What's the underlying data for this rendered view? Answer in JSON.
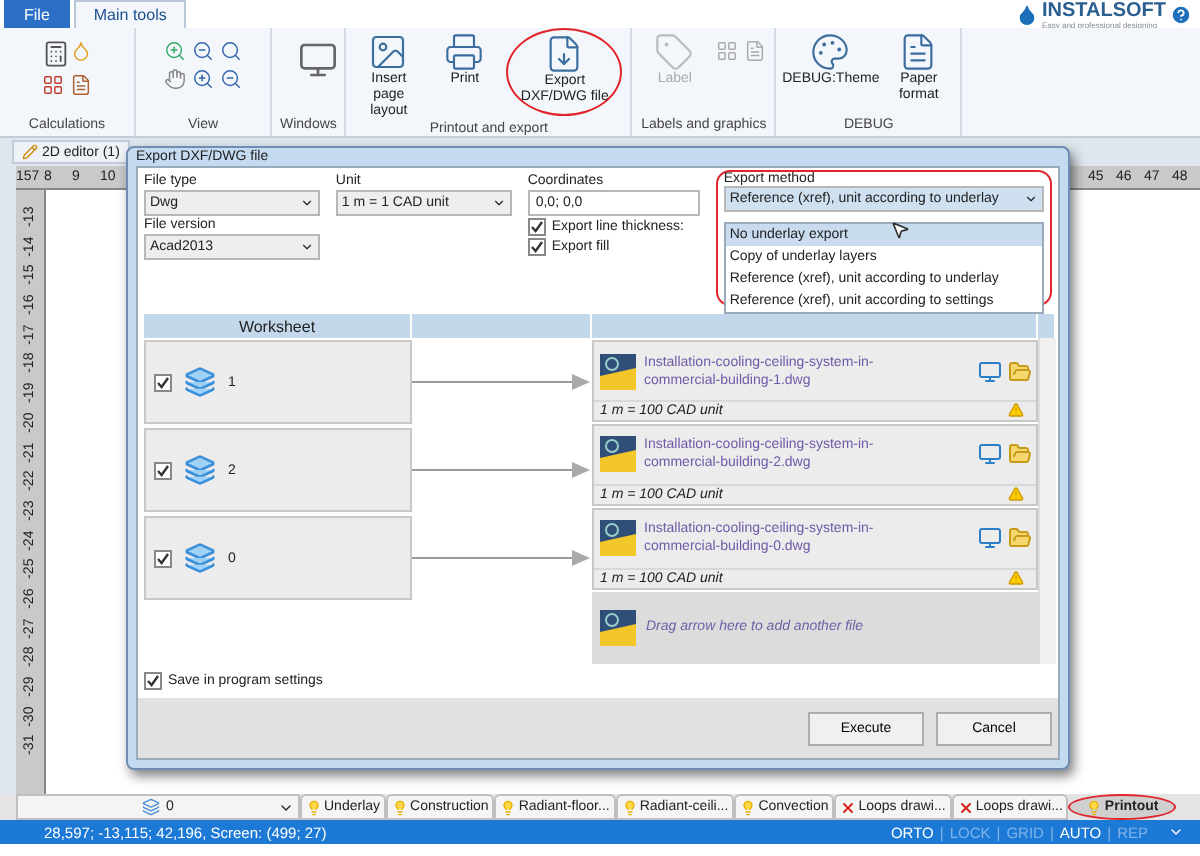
{
  "menu_tabs": [
    {
      "label": "File",
      "selected": false,
      "kind": "file"
    },
    {
      "label": "Main tools",
      "selected": true,
      "kind": "tab"
    }
  ],
  "brand": {
    "name": "INSTALSOFT",
    "tagline": "Easy and professional designing"
  },
  "ribbon_groups": [
    {
      "kind": "calculations",
      "label": "Calculations"
    },
    {
      "kind": "view",
      "label": "View"
    },
    {
      "kind": "windows",
      "label": "Windows"
    },
    {
      "kind": "printout",
      "label": "Printout and export",
      "buttons": [
        {
          "label": "Insert page layout",
          "disabled": false
        },
        {
          "label": "Print",
          "disabled": false
        },
        {
          "label": "Export DXF/DWG file",
          "disabled": false
        }
      ]
    },
    {
      "kind": "labels",
      "label": "Labels and graphics",
      "buttons": [
        {
          "label": "Label",
          "disabled": true
        }
      ]
    },
    {
      "kind": "debug",
      "label": "DEBUG",
      "buttons": [
        {
          "label": "DEBUG:Theme",
          "disabled": false
        },
        {
          "label": "Paper format",
          "disabled": false
        }
      ]
    }
  ],
  "editor_tab": {
    "label": "2D editor (1)"
  },
  "top_ruler": {
    "corner": "157",
    "left_ticks": [
      "8",
      "9",
      "10"
    ],
    "right_ticks": [
      "45",
      "46",
      "47",
      "48"
    ]
  },
  "left_ruler": [
    "-13",
    "-14",
    "-15",
    "-16",
    "-17",
    "-18",
    "-19",
    "-20",
    "-21",
    "-22",
    "-23",
    "-24",
    "-25",
    "-26",
    "-27",
    "-28",
    "-29",
    "-30",
    "-31"
  ],
  "dialog": {
    "title": "Export DXF/DWG file",
    "file_type": {
      "label": "File type",
      "value": "Dwg"
    },
    "file_version": {
      "label": "File version",
      "value": "Acad2013"
    },
    "unit": {
      "label": "Unit",
      "value": "1 m = 1 CAD unit"
    },
    "coordinates": {
      "label": "Coordinates",
      "value": "0,0; 0,0"
    },
    "options": [
      {
        "label": "Export line thickness:",
        "checked": true
      },
      {
        "label": "Export fill",
        "checked": true
      }
    ],
    "export_method": {
      "label": "Export method",
      "value": "Reference (xref), unit according to underlay",
      "expanded": true,
      "choices": [
        {
          "label": "No underlay export",
          "highlighted": true
        },
        {
          "label": "Copy of underlay layers",
          "highlighted": false
        },
        {
          "label": "Reference (xref), unit according to underlay",
          "highlighted": false
        },
        {
          "label": "Reference (xref), unit according to settings",
          "highlighted": false
        }
      ]
    },
    "worksheet_header": "Worksheet",
    "rows": [
      {
        "sheet": "1",
        "checked": true,
        "file": "Installation-cooling-ceiling-system-in-commercial-building-1.dwg",
        "scale": "1 m = 100 CAD unit"
      },
      {
        "sheet": "2",
        "checked": true,
        "file": "Installation-cooling-ceiling-system-in-commercial-building-2.dwg",
        "scale": "1 m = 100 CAD unit"
      },
      {
        "sheet": "0",
        "checked": true,
        "file": "Installation-cooling-ceiling-system-in-commercial-building-0.dwg",
        "scale": "1 m = 100 CAD unit"
      }
    ],
    "drop_hint": "Drag arrow here to add another file",
    "save_settings": {
      "label": "Save in program settings",
      "checked": true
    },
    "buttons": [
      "Execute",
      "Cancel"
    ]
  },
  "layer_select": {
    "value": "0"
  },
  "layer_tabs": [
    {
      "label": "Underlay",
      "kind": "bulb",
      "selected": false
    },
    {
      "label": "Construction",
      "kind": "bulb",
      "selected": false
    },
    {
      "label": "Radiant-floor...",
      "kind": "bulb",
      "selected": false
    },
    {
      "label": "Radiant-ceili...",
      "kind": "bulb",
      "selected": false
    },
    {
      "label": "Convection",
      "kind": "bulb",
      "selected": false
    },
    {
      "label": "Loops drawi...",
      "kind": "crossed",
      "selected": false
    },
    {
      "label": "Loops drawi...",
      "kind": "crossed",
      "selected": false
    },
    {
      "label": "Printout",
      "kind": "bulb",
      "selected": true
    }
  ],
  "status_bar": {
    "coordinates": "28,597; -13,115; 42,196, Screen: (499; 27)",
    "separator": "|",
    "modes": [
      {
        "label": "ORTO",
        "on": true
      },
      {
        "label": "LOCK",
        "on": false
      },
      {
        "label": "GRID",
        "on": false
      },
      {
        "label": "AUTO",
        "on": true
      },
      {
        "label": "REP",
        "on": false
      }
    ]
  }
}
